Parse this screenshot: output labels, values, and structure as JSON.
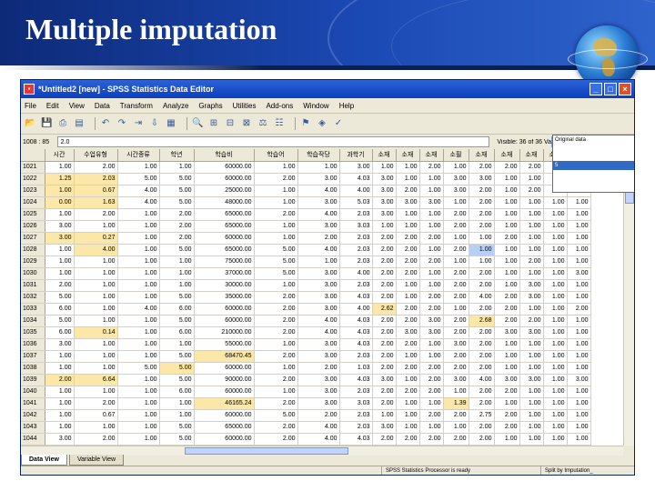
{
  "slide": {
    "title": "Multiple imputation"
  },
  "window": {
    "title": "*Untitled2 [new] - SPSS Statistics Data Editor"
  },
  "menu": [
    "File",
    "Edit",
    "View",
    "Data",
    "Transform",
    "Analyze",
    "Graphs",
    "Utilities",
    "Add-ons",
    "Window",
    "Help"
  ],
  "cell_editor": {
    "ref": "1008 : 85",
    "value": "2.0",
    "visible": "Visible: 36 of 36 Variables",
    "split_value": "5"
  },
  "split_dropdown": {
    "items": [
      "Original data",
      "1",
      "2",
      "3",
      "4",
      "5"
    ]
  },
  "columns": [
    "",
    "시간",
    "수업유형",
    "시간종류",
    "학년",
    "학습비",
    "학습어",
    "학습작당",
    "과학기",
    "소재",
    "소재",
    "소재",
    "소필",
    "소재",
    "소재",
    "소재",
    "소재",
    "소재"
  ],
  "rows": [
    [
      "1021",
      "1.00",
      "2.00",
      "1.00",
      "1.00",
      "60000.00",
      "1.00",
      "1.00",
      "3.00",
      "1.00",
      "1.00",
      "2.00",
      "1.00",
      "2.00",
      "2.00",
      "2.00",
      "2.00",
      "1.00"
    ],
    [
      "1022",
      "1.25",
      "2.03",
      "5.00",
      "5.00",
      "60000.00",
      "2.00",
      "3.00",
      "4.03",
      "3.00",
      "1.00",
      "1.00",
      "3.00",
      "3.00",
      "1.00",
      "1.00",
      "1.00",
      "1.00"
    ],
    [
      "1023",
      "1.00",
      "0.67",
      "4.00",
      "5.00",
      "25000.00",
      "1.00",
      "4.00",
      "4.00",
      "3.00",
      "2.00",
      "1.00",
      "3.00",
      "2.00",
      "1.00",
      "2.00",
      "1.00",
      "1.00"
    ],
    [
      "1024",
      "0.00",
      "1.63",
      "4.00",
      "5.00",
      "48000.00",
      "1.00",
      "3.00",
      "5.03",
      "3.00",
      "3.00",
      "3.00",
      "1.00",
      "2.00",
      "1.00",
      "1.00",
      "1.00",
      "1.00"
    ],
    [
      "1025",
      "1.00",
      "2.00",
      "1.00",
      "2.00",
      "65000.00",
      "2.00",
      "4.00",
      "2.03",
      "3.00",
      "1.00",
      "1.00",
      "2.00",
      "2.00",
      "1.00",
      "1.00",
      "1.00",
      "1.00"
    ],
    [
      "1026",
      "3.00",
      "1.00",
      "1.00",
      "2.00",
      "65000.00",
      "1.00",
      "3.00",
      "3.03",
      "1.00",
      "1.00",
      "1.00",
      "2.00",
      "2.00",
      "1.00",
      "1.00",
      "1.00",
      "1.00"
    ],
    [
      "1027",
      "3.00",
      "0.27",
      "1.00",
      "2.00",
      "60000.00",
      "1.00",
      "2.00",
      "2.03",
      "2.00",
      "2.00",
      "2.00",
      "1.00",
      "1.00",
      "2.00",
      "1.00",
      "1.00",
      "1.00"
    ],
    [
      "1028",
      "1.00",
      "4.00",
      "1.00",
      "5.00",
      "65000.00",
      "5.00",
      "4.00",
      "2.03",
      "2.00",
      "2.00",
      "1.00",
      "2.00",
      "1.00",
      "1.00",
      "1.00",
      "1.00",
      "1.00"
    ],
    [
      "1029",
      "1.00",
      "1.00",
      "1.00",
      "1.00",
      "75000.00",
      "5.00",
      "1.00",
      "2.03",
      "2.00",
      "2.00",
      "2.00",
      "1.00",
      "1.00",
      "1.00",
      "2.00",
      "1.00",
      "1.00"
    ],
    [
      "1030",
      "1.00",
      "1.00",
      "1.00",
      "1.00",
      "37000.00",
      "5.00",
      "3.00",
      "4.00",
      "2.00",
      "2.00",
      "1.00",
      "2.00",
      "2.00",
      "1.00",
      "1.00",
      "1.00",
      "3.00"
    ],
    [
      "1031",
      "2.00",
      "1.00",
      "1.00",
      "1.00",
      "30000.00",
      "1.00",
      "3.00",
      "2.03",
      "2.00",
      "1.00",
      "1.00",
      "2.00",
      "2.00",
      "1.00",
      "3.00",
      "1.00",
      "1.00"
    ],
    [
      "1032",
      "5.00",
      "1.00",
      "1.00",
      "5.00",
      "35000.00",
      "2.00",
      "3.00",
      "4.03",
      "2.00",
      "1.00",
      "2.00",
      "2.00",
      "4.00",
      "2.00",
      "3.00",
      "1.00",
      "1.00"
    ],
    [
      "1033",
      "6.00",
      "1.00",
      "4.00",
      "6.00",
      "60000.00",
      "2.00",
      "3.00",
      "4.00",
      "2.62",
      "2.00",
      "2.00",
      "1.00",
      "2.00",
      "2.00",
      "1.00",
      "1.00",
      "2.00"
    ],
    [
      "1034",
      "5.00",
      "1.00",
      "1.00",
      "5.00",
      "60000.00",
      "2.00",
      "4.00",
      "4.03",
      "2.00",
      "2.00",
      "3.00",
      "2.00",
      "2.68",
      "2.00",
      "2.00",
      "1.00",
      "1.00"
    ],
    [
      "1035",
      "6.00",
      "0.14",
      "1.00",
      "6.00",
      "210000.00",
      "2.00",
      "4.00",
      "4.03",
      "2.00",
      "3.00",
      "3.00",
      "2.00",
      "2.00",
      "3.00",
      "3.00",
      "1.00",
      "1.00"
    ],
    [
      "1036",
      "3.00",
      "1.00",
      "1.00",
      "1.00",
      "55000.00",
      "1.00",
      "3.00",
      "4.03",
      "2.00",
      "2.00",
      "1.00",
      "3.00",
      "2.00",
      "1.00",
      "1.00",
      "1.00",
      "1.00"
    ],
    [
      "1037",
      "1.00",
      "1.00",
      "1.00",
      "5.00",
      "68470.45",
      "2.00",
      "3.00",
      "2.03",
      "2.00",
      "1.00",
      "1.00",
      "2.00",
      "2.00",
      "1.00",
      "1.00",
      "1.00",
      "1.00"
    ],
    [
      "1038",
      "1.00",
      "1.00",
      "5.00",
      "5.00",
      "60000.00",
      "1.00",
      "2.00",
      "1.03",
      "2.00",
      "2.00",
      "2.00",
      "2.00",
      "2.00",
      "1.00",
      "1.00",
      "1.00",
      "1.00"
    ],
    [
      "1039",
      "2.00",
      "6.64",
      "1.00",
      "5.00",
      "90000.00",
      "2.00",
      "3.00",
      "4.03",
      "3.00",
      "1.00",
      "2.00",
      "3.00",
      "4.00",
      "3.00",
      "3.00",
      "1.00",
      "3.00"
    ],
    [
      "1040",
      "1.00",
      "1.00",
      "1.00",
      "6.00",
      "60000.00",
      "1.00",
      "3.00",
      "2.03",
      "2.00",
      "2.00",
      "2.00",
      "1.00",
      "2.00",
      "2.00",
      "1.00",
      "1.00",
      "1.00"
    ],
    [
      "1041",
      "1.00",
      "2.00",
      "1.00",
      "1.00",
      "46165.24",
      "2.00",
      "3.00",
      "3.03",
      "2.00",
      "1.00",
      "1.00",
      "1.39",
      "2.00",
      "1.00",
      "1.00",
      "1.00",
      "1.00"
    ],
    [
      "1042",
      "1.00",
      "0.67",
      "1.00",
      "1.00",
      "60000.00",
      "5.00",
      "2.00",
      "2.03",
      "1.00",
      "1.00",
      "2.00",
      "2.00",
      "2.75",
      "2.00",
      "1.00",
      "1.00",
      "1.00"
    ],
    [
      "1043",
      "1.00",
      "1.00",
      "1.00",
      "5.00",
      "65000.00",
      "2.00",
      "4.00",
      "2.03",
      "3.00",
      "1.00",
      "1.00",
      "1.00",
      "2.00",
      "2.00",
      "1.00",
      "1.00",
      "1.00"
    ],
    [
      "1044",
      "3.00",
      "2.00",
      "1.00",
      "5.00",
      "60000.00",
      "2.00",
      "4.00",
      "4.03",
      "2.00",
      "2.00",
      "2.00",
      "2.00",
      "2.00",
      "1.00",
      "1.00",
      "1.00",
      "1.00"
    ]
  ],
  "imputed_cells": [
    [
      1,
      1
    ],
    [
      1,
      2
    ],
    [
      2,
      1
    ],
    [
      2,
      2
    ],
    [
      3,
      1
    ],
    [
      3,
      2
    ],
    [
      6,
      1
    ],
    [
      6,
      2
    ],
    [
      7,
      2
    ],
    [
      12,
      9
    ],
    [
      13,
      13
    ],
    [
      14,
      2
    ],
    [
      16,
      5
    ],
    [
      17,
      4
    ],
    [
      18,
      1
    ],
    [
      18,
      2
    ],
    [
      20,
      5
    ],
    [
      20,
      12
    ]
  ],
  "selected_cells": [
    [
      7,
      13
    ]
  ],
  "tabs": [
    "Data View",
    "Variable View"
  ],
  "status": {
    "processor": "SPSS Statistics  Processor is ready",
    "split": "Split by Imputation_"
  },
  "colors": {
    "imputed_cell": "#fbe7a8",
    "selected_cell": "#b8d0f4",
    "title_bar": "#0b3fbe",
    "slide_header": "#1b49b4"
  }
}
